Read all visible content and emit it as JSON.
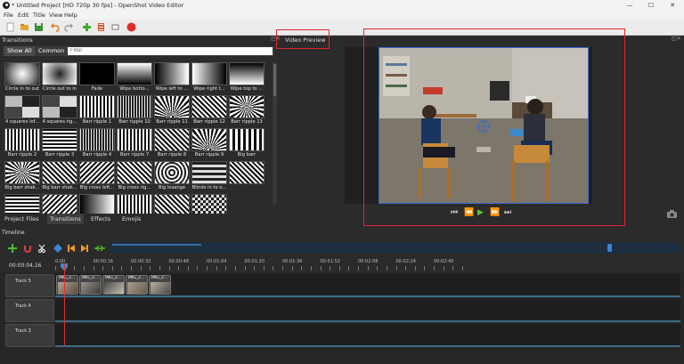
{
  "window": {
    "title": "* Untitled Project [HD 720p 30 fps] - OpenShot Video Editor",
    "minimize": "—",
    "maximize": "☐",
    "close": "✕"
  },
  "menu": [
    "File",
    "Edit",
    "Title",
    "View",
    "Help"
  ],
  "transitions": {
    "panel_title": "Transitions",
    "tabs": {
      "show_all": "Show All",
      "common": "Common"
    },
    "filter_placeholder": "Filter",
    "items": [
      {
        "label": "Circle in to out",
        "pattern": "radial-in"
      },
      {
        "label": "Circle out to in",
        "pattern": "radial-out"
      },
      {
        "label": "Fade",
        "pattern": "black"
      },
      {
        "label": "Wipe botto...",
        "pattern": "grad-v"
      },
      {
        "label": "Wipe left to ...",
        "pattern": "grad-h"
      },
      {
        "label": "Wipe right t...",
        "pattern": "grad-h-rev"
      },
      {
        "label": "Wipe top to ...",
        "pattern": "grad-v-rev"
      },
      {
        "label": "4 squares lef...",
        "pattern": "squares"
      },
      {
        "label": "4 squares rig...",
        "pattern": "squares2"
      },
      {
        "label": "Barr ripple 1",
        "pattern": "stripes-v"
      },
      {
        "label": "Barr ripple 10",
        "pattern": "stripes-v-fine"
      },
      {
        "label": "Barr ripple 11",
        "pattern": "rays"
      },
      {
        "label": "Barr ripple 12",
        "pattern": "stripes-d"
      },
      {
        "label": "Barr ripple 13",
        "pattern": "rays2"
      },
      {
        "label": "Barr ripple 2",
        "pattern": "stripes-v"
      },
      {
        "label": "Barr ripple 3",
        "pattern": "stripes-h"
      },
      {
        "label": "Barr ripple 4",
        "pattern": "stripes-v-fine"
      },
      {
        "label": "Barr ripple 7",
        "pattern": "stripes-v"
      },
      {
        "label": "Barr ripple 8",
        "pattern": "stripes-d"
      },
      {
        "label": "Barr ripple 9",
        "pattern": "rays"
      },
      {
        "label": "Big barr",
        "pattern": "stripes-v-wide"
      },
      {
        "label": "Big barr shak...",
        "pattern": "rays2"
      },
      {
        "label": "Big barr shak...",
        "pattern": "stripes-d"
      },
      {
        "label": "Big cross left...",
        "pattern": "stripes-d2"
      },
      {
        "label": "Big cross rig...",
        "pattern": "stripes-d"
      },
      {
        "label": "Big losange",
        "pattern": "diamond"
      },
      {
        "label": "Blinds in to o...",
        "pattern": "stripes-h-wide"
      },
      {
        "label": "",
        "pattern": "stripes-d"
      },
      {
        "label": "",
        "pattern": "stripes-h"
      },
      {
        "label": "",
        "pattern": "stripes-d2"
      },
      {
        "label": "",
        "pattern": "grad-h"
      },
      {
        "label": "",
        "pattern": "stripes-v"
      },
      {
        "label": "",
        "pattern": "stripes-d"
      },
      {
        "label": "",
        "pattern": "checker"
      }
    ]
  },
  "bottom_tabs": [
    "Project Files",
    "Transitions",
    "Effects",
    "Emojis"
  ],
  "preview": {
    "panel_title": "Video Preview",
    "controls": {
      "jump_start": "⏮",
      "rewind": "⏪",
      "play": "▶",
      "fast_forward": "⏩",
      "jump_end": "⏭"
    }
  },
  "timeline": {
    "title": "Timeline",
    "current_time": "00:00:04,16",
    "ruler": [
      "0:00",
      "00:00:16",
      "00:00:32",
      "00:00:48",
      "00:01:04",
      "00:01:20",
      "00:01:36",
      "00:01:52",
      "00:02:08",
      "00:02:24",
      "00:02:40"
    ],
    "tracks": [
      {
        "name": "Track 5",
        "clips": [
          "IMG_2...",
          "IMG_2...",
          "IMG_2...",
          "IMG_2...",
          "IMG_2..."
        ]
      },
      {
        "name": "Track 4",
        "clips": []
      },
      {
        "name": "Track 3",
        "clips": []
      }
    ]
  },
  "colors": {
    "accent": "#e0282d",
    "panel_bg": "#2b2b2b",
    "timeline_blue": "#3c6e88"
  }
}
